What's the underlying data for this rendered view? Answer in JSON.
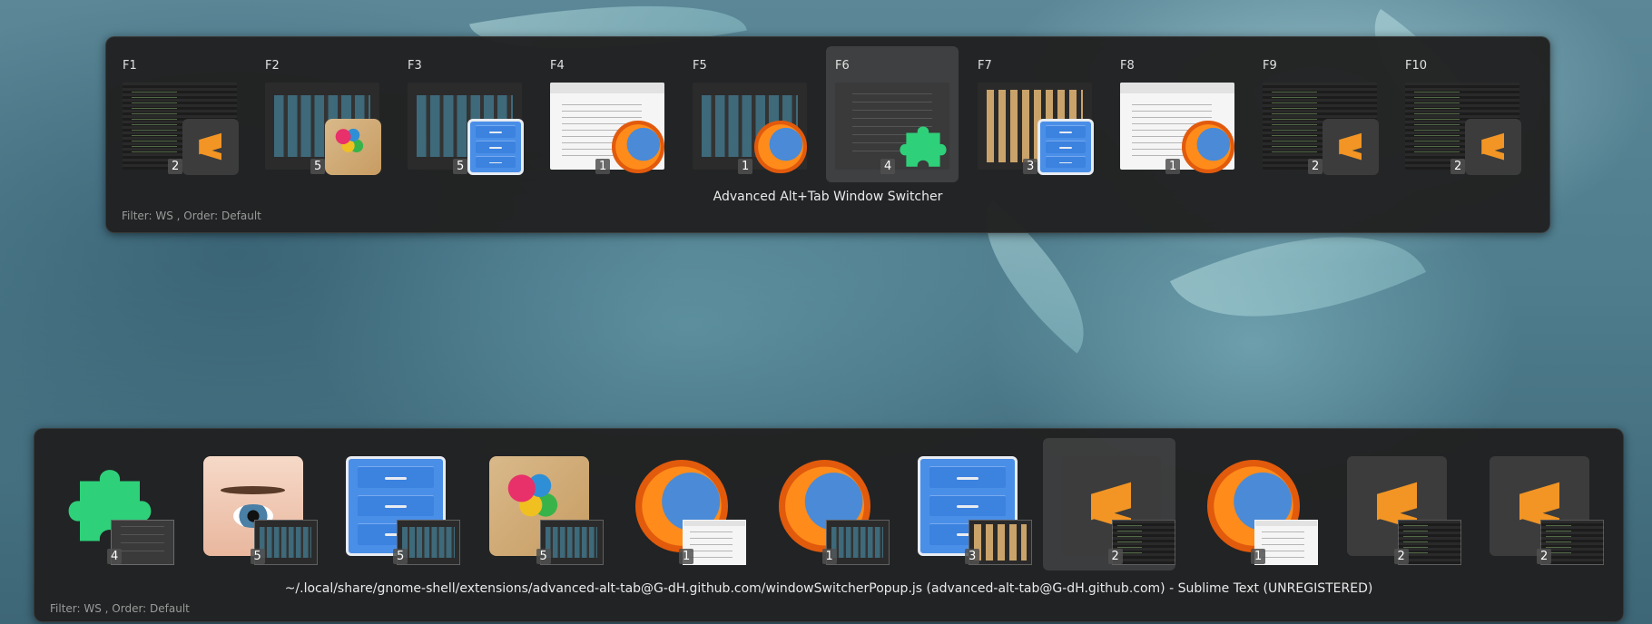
{
  "colors": {
    "sublime": "#f29524",
    "puzzle": "#2fd07a",
    "panel": "#202020",
    "files_blue": "#4a8fe7"
  },
  "top_switcher": {
    "title": "Advanced Alt+Tab Window Switcher",
    "filter_text": "Filter: WS ,  Order: Default",
    "selected_index": 5,
    "windows": [
      {
        "key": "F1",
        "workspace": "2",
        "app_icon": "sublime-text-icon",
        "thumb": "code"
      },
      {
        "key": "F2",
        "workspace": "5",
        "app_icon": "paint-icon",
        "thumb": "darkui"
      },
      {
        "key": "F3",
        "workspace": "5",
        "app_icon": "file-manager-icon",
        "thumb": "darkui"
      },
      {
        "key": "F4",
        "workspace": "1",
        "app_icon": "firefox-icon",
        "thumb": "web"
      },
      {
        "key": "F5",
        "workspace": "1",
        "app_icon": "firefox-icon",
        "thumb": "darkui"
      },
      {
        "key": "F6",
        "workspace": "4",
        "app_icon": "extensions-puzzle-icon",
        "thumb": "settings"
      },
      {
        "key": "F7",
        "workspace": "3",
        "app_icon": "file-manager-icon",
        "thumb": "grid"
      },
      {
        "key": "F8",
        "workspace": "1",
        "app_icon": "firefox-icon",
        "thumb": "web"
      },
      {
        "key": "F9",
        "workspace": "2",
        "app_icon": "sublime-text-icon",
        "thumb": "code"
      },
      {
        "key": "F10",
        "workspace": "2",
        "app_icon": "sublime-text-icon",
        "thumb": "code"
      }
    ]
  },
  "bottom_switcher": {
    "title": "~/.local/share/gnome-shell/extensions/advanced-alt-tab@G-dH.github.com/windowSwitcherPopup.js (advanced-alt-tab@G-dH.github.com) - Sublime Text (UNREGISTERED)",
    "filter_text": "Filter: WS ,  Order: Default",
    "selected_index": 7,
    "windows": [
      {
        "workspace": "4",
        "app_icon": "extensions-puzzle-icon",
        "thumb": "settings"
      },
      {
        "workspace": "5",
        "app_icon": "eye-of-gnome-icon",
        "thumb": "darkui"
      },
      {
        "workspace": "5",
        "app_icon": "file-manager-icon",
        "thumb": "darkui"
      },
      {
        "workspace": "5",
        "app_icon": "paint-icon",
        "thumb": "darkui"
      },
      {
        "workspace": "1",
        "app_icon": "firefox-icon",
        "thumb": "web"
      },
      {
        "workspace": "1",
        "app_icon": "firefox-icon",
        "thumb": "darkui"
      },
      {
        "workspace": "3",
        "app_icon": "file-manager-icon",
        "thumb": "grid"
      },
      {
        "workspace": "2",
        "app_icon": "sublime-text-icon",
        "thumb": "code"
      },
      {
        "workspace": "1",
        "app_icon": "firefox-icon",
        "thumb": "web"
      },
      {
        "workspace": "2",
        "app_icon": "sublime-text-icon",
        "thumb": "code"
      },
      {
        "workspace": "2",
        "app_icon": "sublime-text-icon",
        "thumb": "code"
      }
    ]
  }
}
